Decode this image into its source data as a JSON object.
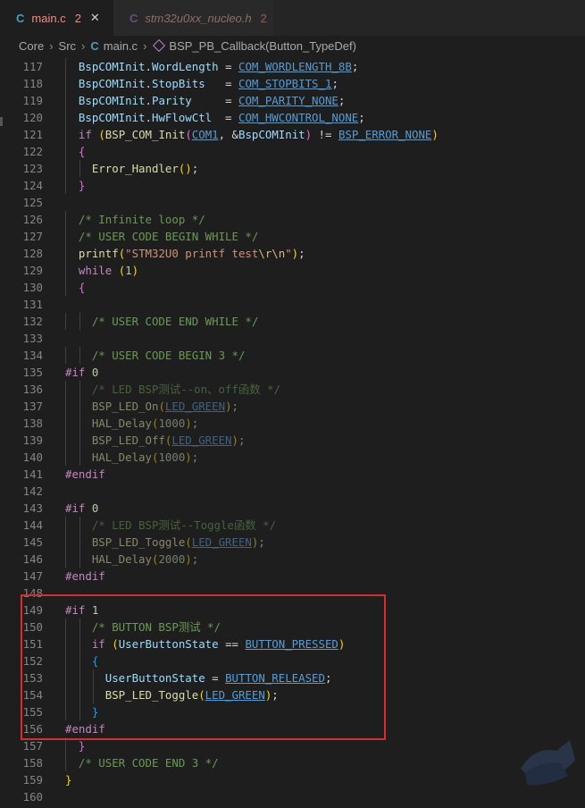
{
  "tabs": [
    {
      "lang": "C",
      "name": "main.c",
      "problems": "2",
      "close": "✕"
    },
    {
      "lang": "C",
      "name": "stm32u0xx_nucleo.h",
      "problems": "2"
    }
  ],
  "breadcrumbs": {
    "core": "Core",
    "src": "Src",
    "file_lang": "C",
    "file": "main.c",
    "symbol": "BSP_PB_Callback(Button_TypeDef)",
    "sep": "›"
  },
  "icons": {
    "symbol": "cube-icon",
    "close": "close-icon"
  },
  "colors": {
    "highlight_box": "#e0282e",
    "problem_text": "#f28b82"
  },
  "lines": [
    {
      "n": "117",
      "t": "  BspCOMInit.WordLength = COM_WORDLENGTH_8B;"
    },
    {
      "n": "118",
      "t": "  BspCOMInit.StopBits   = COM_STOPBITS_1;"
    },
    {
      "n": "119",
      "t": "  BspCOMInit.Parity     = COM_PARITY_NONE;"
    },
    {
      "n": "120",
      "t": "  BspCOMInit.HwFlowCtl  = COM_HWCONTROL_NONE;"
    },
    {
      "n": "121",
      "t": "  if (BSP_COM_Init(COM1, &BspCOMInit) != BSP_ERROR_NONE)"
    },
    {
      "n": "122",
      "t": "  {"
    },
    {
      "n": "123",
      "t": "    Error_Handler();"
    },
    {
      "n": "124",
      "t": "  }"
    },
    {
      "n": "125",
      "t": ""
    },
    {
      "n": "126",
      "t": "  /* Infinite loop */"
    },
    {
      "n": "127",
      "t": "  /* USER CODE BEGIN WHILE */"
    },
    {
      "n": "128",
      "t": "  printf(\"STM32U0 printf test\\r\\n\");"
    },
    {
      "n": "129",
      "t": "  while (1)"
    },
    {
      "n": "130",
      "t": "  {"
    },
    {
      "n": "131",
      "t": ""
    },
    {
      "n": "132",
      "t": "    /* USER CODE END WHILE */"
    },
    {
      "n": "133",
      "t": ""
    },
    {
      "n": "134",
      "t": "    /* USER CODE BEGIN 3 */"
    },
    {
      "n": "135",
      "t": "#if 0"
    },
    {
      "n": "136",
      "t": "    /* LED BSP测试--on、off函数 */"
    },
    {
      "n": "137",
      "t": "    BSP_LED_On(LED_GREEN);"
    },
    {
      "n": "138",
      "t": "    HAL_Delay(1000);"
    },
    {
      "n": "139",
      "t": "    BSP_LED_Off(LED_GREEN);"
    },
    {
      "n": "140",
      "t": "    HAL_Delay(1000);"
    },
    {
      "n": "141",
      "t": "#endif"
    },
    {
      "n": "142",
      "t": ""
    },
    {
      "n": "143",
      "t": "#if 0"
    },
    {
      "n": "144",
      "t": "    /* LED BSP测试--Toggle函数 */"
    },
    {
      "n": "145",
      "t": "    BSP_LED_Toggle(LED_GREEN);"
    },
    {
      "n": "146",
      "t": "    HAL_Delay(2000);"
    },
    {
      "n": "147",
      "t": "#endif"
    },
    {
      "n": "148",
      "t": ""
    },
    {
      "n": "149",
      "t": "#if 1"
    },
    {
      "n": "150",
      "t": "    /* BUTTON BSP测试 */"
    },
    {
      "n": "151",
      "t": "    if (UserButtonState == BUTTON_PRESSED)"
    },
    {
      "n": "152",
      "t": "    {"
    },
    {
      "n": "153",
      "t": "      UserButtonState = BUTTON_RELEASED;"
    },
    {
      "n": "154",
      "t": "      BSP_LED_Toggle(LED_GREEN);"
    },
    {
      "n": "155",
      "t": "    }"
    },
    {
      "n": "156",
      "t": "#endif"
    },
    {
      "n": "157",
      "t": "  }"
    },
    {
      "n": "158",
      "t": "  /* USER CODE END 3 */"
    },
    {
      "n": "159",
      "t": "}"
    },
    {
      "n": "160",
      "t": ""
    }
  ]
}
